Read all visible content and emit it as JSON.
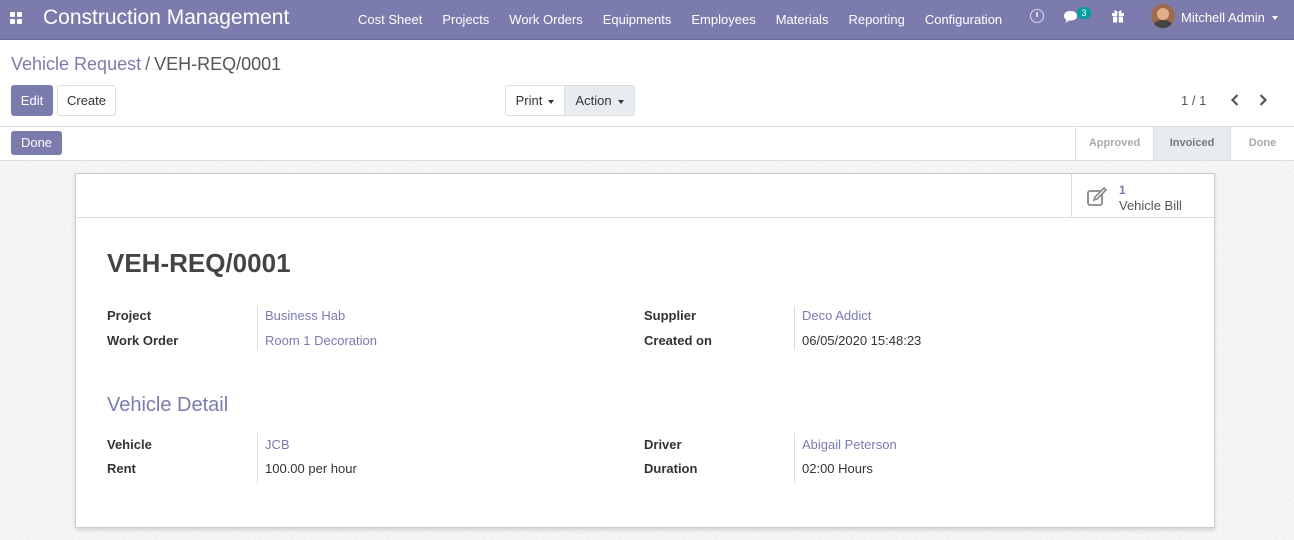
{
  "navbar": {
    "app_title": "Construction Management",
    "menu": [
      "Cost Sheet",
      "Projects",
      "Work Orders",
      "Equipments",
      "Employees",
      "Materials",
      "Reporting",
      "Configuration"
    ],
    "chat_count": "3",
    "user_name": "Mitchell Admin",
    "accent_color": "#7c7bad"
  },
  "breadcrumb": {
    "parent": "Vehicle Request",
    "separator": "/",
    "current": "VEH-REQ/0001"
  },
  "control_panel": {
    "edit_label": "Edit",
    "create_label": "Create",
    "print_label": "Print",
    "action_label": "Action",
    "pager": "1 / 1"
  },
  "statusbar": {
    "done_label": "Done",
    "stages": [
      "Approved",
      "Invoiced",
      "Done"
    ],
    "active_stage": "Invoiced"
  },
  "sheet": {
    "smart_button": {
      "count": "1",
      "label": "Vehicle Bill",
      "icon": "edit-icon"
    },
    "title": "VEH-REQ/0001",
    "fields_top": {
      "project_label": "Project",
      "project_value": "Business Hab",
      "work_order_label": "Work Order",
      "work_order_value": "Room 1 Decoration",
      "supplier_label": "Supplier",
      "supplier_value": "Deco Addict",
      "created_on_label": "Created on",
      "created_on_value": "06/05/2020 15:48:23"
    },
    "section_title": "Vehicle Detail",
    "fields_vehicle": {
      "vehicle_label": "Vehicle",
      "vehicle_value": "JCB",
      "rent_label": "Rent",
      "rent_value": "100.00",
      "rent_unit": "per hour",
      "driver_label": "Driver",
      "driver_value": "Abigail Peterson",
      "duration_label": "Duration",
      "duration_value": "02:00",
      "duration_unit": "Hours"
    }
  }
}
